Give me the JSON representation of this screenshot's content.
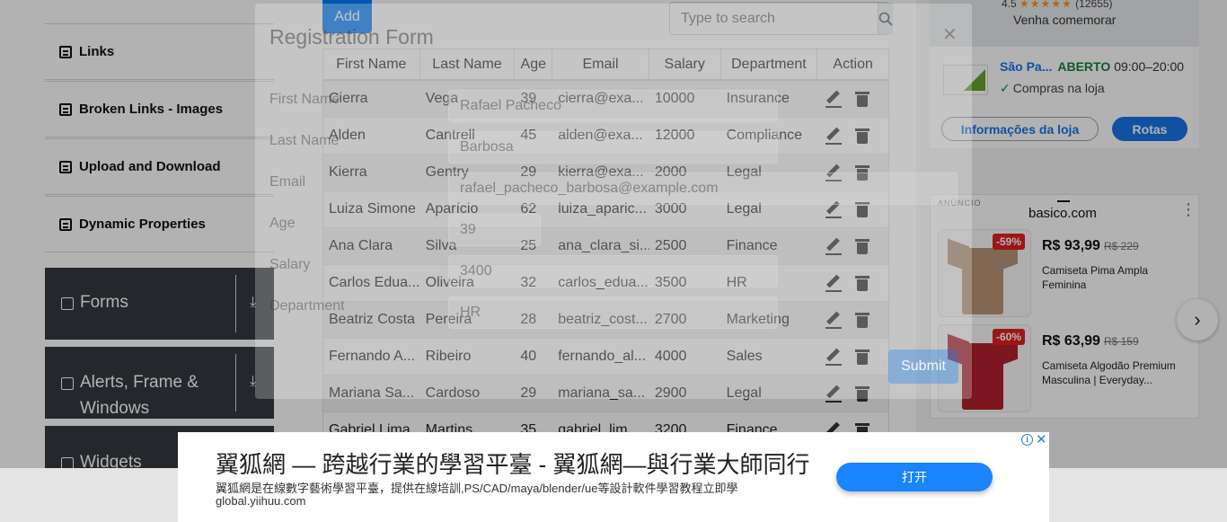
{
  "sidebar": {
    "items": [
      {
        "label": "Links"
      },
      {
        "label": "Broken Links - Images"
      },
      {
        "label": "Upload and Download"
      },
      {
        "label": "Dynamic Properties"
      }
    ],
    "groups": [
      {
        "label": "Forms"
      },
      {
        "label": "Alerts, Frame &",
        "label2": "Windows"
      },
      {
        "label": "Widgets"
      }
    ]
  },
  "toolbar": {
    "add_label": "Add",
    "search_placeholder": "Type to search"
  },
  "table": {
    "headers": [
      "First Name",
      "Last Name",
      "Age",
      "Email",
      "Salary",
      "Department",
      "Action"
    ],
    "rows": [
      [
        "Cierra",
        "Vega",
        "39",
        "cierra@exa...",
        "10000",
        "Insurance"
      ],
      [
        "Alden",
        "Cantrell",
        "45",
        "alden@exa...",
        "12000",
        "Compliance"
      ],
      [
        "Kierra",
        "Gentry",
        "29",
        "kierra@exa...",
        "2000",
        "Legal"
      ],
      [
        "Luiza Simone",
        "Aparício",
        "62",
        "luiza_aparic...",
        "3000",
        "Legal"
      ],
      [
        "Ana Clara",
        "Silva",
        "25",
        "ana_clara_si...",
        "2500",
        "Finance"
      ],
      [
        "Carlos Edua...",
        "Oliveira",
        "32",
        "carlos_edua...",
        "3500",
        "HR"
      ],
      [
        "Beatriz Costa",
        "Pereira",
        "28",
        "beatriz_cost...",
        "2700",
        "Marketing"
      ],
      [
        "Fernando A...",
        "Ribeiro",
        "40",
        "fernando_al...",
        "4000",
        "Sales"
      ],
      [
        "Mariana Sa...",
        "Cardoso",
        "29",
        "mariana_sa...",
        "2900",
        "Legal"
      ],
      [
        "Gabriel Lima",
        "Martins",
        "35",
        "gabriel_lim...",
        "3200",
        "Finance"
      ]
    ]
  },
  "modal": {
    "title": "Registration Form",
    "fields": [
      {
        "label": "First Name",
        "value": "Rafael Pacheco"
      },
      {
        "label": "Last Name",
        "value": "Barbosa"
      },
      {
        "label": "Email",
        "value": "rafael_pacheco_barbosa@example.com"
      },
      {
        "label": "Age",
        "value": "39"
      },
      {
        "label": "Salary",
        "value": "3400"
      },
      {
        "label": "Department",
        "value": "HR"
      }
    ],
    "submit_label": "Submit"
  },
  "maps_ad": {
    "rating": "4.5",
    "stars": "★★★★★",
    "reviews": "(12655)",
    "tagline": "Venha comemorar",
    "store_name": "São Pa...",
    "status": "ABERTO",
    "hours": "09:00–20:00",
    "feature": "Compras na loja",
    "info_button": "Informações da loja",
    "route_button": "Rotas"
  },
  "shop_ad": {
    "label": "ANÚNCIO",
    "brand": "basico.com",
    "products": [
      {
        "discount": "-59%",
        "price": "R$ 93,99",
        "old_price": "R$ 229",
        "name": "Camiseta Pima Ampla Feminina",
        "color": "#b8957a"
      },
      {
        "discount": "-60%",
        "price": "R$ 63,99",
        "old_price": "R$ 159",
        "name": "Camiseta Algodão Premium Masculina | Everyday...",
        "color": "#b3202b"
      }
    ]
  },
  "banner_ad": {
    "title": "翼狐網 — 跨越行業的學習平臺 - 翼狐網—與行業大師同行",
    "description": "翼狐網是在線數字藝術學習平臺，提供在線培訓,PS/CAD/maya/blender/ue等設計軟件學習教程立即學",
    "url": "global.yiihuu.com",
    "button": "打开"
  }
}
